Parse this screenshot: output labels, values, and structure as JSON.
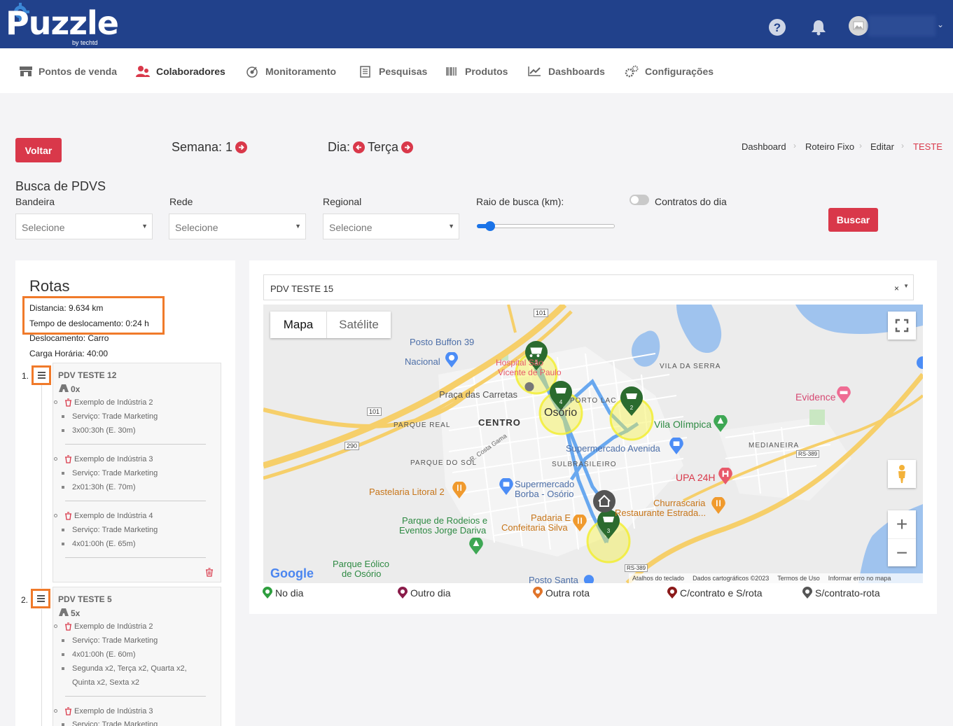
{
  "app": {
    "logo": "Puzzle",
    "logo_sub": "by techtd"
  },
  "topbar": {
    "help_icon": "question-circle-icon",
    "bell_icon": "bell-icon",
    "avatar_icon": "image-icon"
  },
  "nav": {
    "items": [
      {
        "label": "Pontos de venda",
        "icon": "store-icon"
      },
      {
        "label": "Colaboradores",
        "icon": "users-icon"
      },
      {
        "label": "Monitoramento",
        "icon": "radar-icon"
      },
      {
        "label": "Pesquisas",
        "icon": "clipboard-icon"
      },
      {
        "label": "Produtos",
        "icon": "barcode-icon"
      },
      {
        "label": "Dashboards",
        "icon": "chart-line-icon"
      },
      {
        "label": "Configurações",
        "icon": "gears-icon"
      }
    ]
  },
  "header": {
    "back_label": "Voltar",
    "week_label": "Semana: 1",
    "day_label": "Dia:",
    "day_value": "Terça",
    "breadcrumb": [
      "Dashboard",
      "Roteiro Fixo",
      "Editar",
      "TESTE"
    ]
  },
  "search": {
    "title": "Busca de PDVS",
    "bandeira_label": "Bandeira",
    "rede_label": "Rede",
    "regional_label": "Regional",
    "placeholder": "Selecione",
    "raio_label": "Raio de busca (km):",
    "contratos_label": "Contratos do dia",
    "buscar_label": "Buscar"
  },
  "routes": {
    "title": "Rotas",
    "distancia": "Distancia: 9.634 km",
    "tempo": "Tempo de deslocamento: 0:24 h",
    "deslocamento": "Deslocamento: Carro",
    "carga": "Carga Horária: 40:00",
    "pdvs": [
      {
        "num": "1.",
        "name": "PDV TESTE 12",
        "visits": "0x",
        "industries": [
          {
            "name": "Exemplo de Indústria 2",
            "service": "Serviço: Trade Marketing",
            "time": "3x00:30h (E. 30m)"
          },
          {
            "name": "Exemplo de Indústria 3",
            "service": "Serviço: Trade Marketing",
            "time": "2x01:30h (E. 70m)"
          },
          {
            "name": "Exemplo de Indústria 4",
            "service": "Serviço: Trade Marketing",
            "time": "4x01:00h (E. 65m)"
          }
        ]
      },
      {
        "num": "2.",
        "name": "PDV TESTE 5",
        "visits": "5x",
        "industries": [
          {
            "name": "Exemplo de Indústria 2",
            "service": "Serviço: Trade Marketing",
            "time": "4x01:00h (E. 60m)",
            "days1": "Segunda x2, Terça x2, Quarta x2,",
            "days2": "Quinta x2, Sexta x2"
          },
          {
            "name": "Exemplo de Indústria 3",
            "service": "Serviço: Trade Marketing"
          }
        ]
      }
    ]
  },
  "map": {
    "selected_pdv": "PDV TESTE 15",
    "tab_map": "Mapa",
    "tab_satellite": "Satélite",
    "labels": {
      "posto_buffon": "Posto Buffon 39",
      "nacional": "Nacional",
      "hospital1": "Hospital São",
      "hospital2": "Vicente de Paulo",
      "praca": "Praça das Carretas",
      "parque_real": "PARQUE REAL",
      "centro": "CENTRO",
      "osorio": "Osório",
      "porto_lacustre": "PORTO LAC",
      "vila_serra": "VILA DA SERRA",
      "evidence": "Evidence",
      "vila_olimpica": "Vila Olímpica",
      "supermercado_avenida": "Supermercado Avenida",
      "medianeira": "MEDIANEIRA",
      "parque_sol": "PARQUE DO SOL",
      "costa_gama": "R. Costa Gama",
      "sulbrasileiro": "SULBRASILEIRO",
      "upa": "UPA 24H",
      "pastelaria": "Pastelaria Litoral 2",
      "super_borba1": "Supermercado",
      "super_borba2": "Borba - Osório",
      "churrascaria1": "Churrascaria",
      "churrascaria2": "Restaurante Estrada...",
      "padaria1": "Padaria E",
      "padaria2": "Confeitaria Silva",
      "parque_rodeios1": "Parque de Rodeios e",
      "parque_rodeios2": "Eventos Jorge Dariva",
      "parque_eolico1": "Parque Eólico",
      "parque_eolico2": "de Osório",
      "posto_santa": "Posto Santa",
      "r101a": "101",
      "r101b": "101",
      "r290": "290",
      "rs389a": "RS-389",
      "rs389b": "RS-389",
      "google": "Google",
      "atalhos": "Atalhos do teclado",
      "dados": "Dados cartográficos ©2023",
      "termos": "Termos de Uso",
      "informar": "Informar erro no mapa"
    },
    "markers": [
      "1",
      "4",
      "2",
      "3"
    ]
  },
  "legend": [
    {
      "label": "No dia",
      "color": "#2e9e3e"
    },
    {
      "label": "Outro dia",
      "color": "#8a1c4a"
    },
    {
      "label": "Outra rota",
      "color": "#e0742a"
    },
    {
      "label": "C/contrato e S/rota",
      "color": "#8b1a1a"
    },
    {
      "label": "S/contrato-rota",
      "color": "#555555"
    }
  ]
}
